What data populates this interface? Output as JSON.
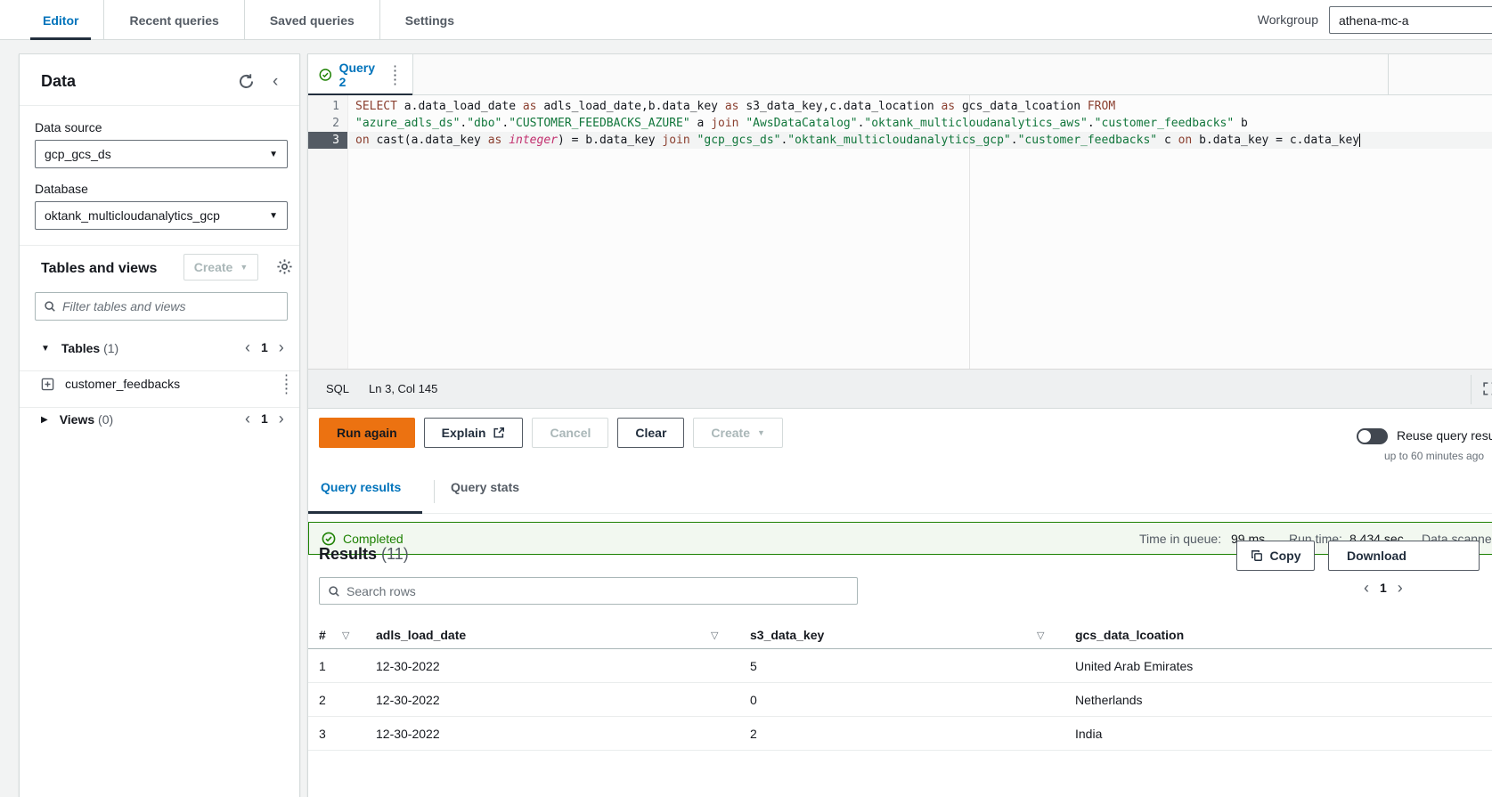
{
  "topnav": {
    "tabs": [
      {
        "label": "Editor"
      },
      {
        "label": "Recent queries"
      },
      {
        "label": "Saved queries"
      },
      {
        "label": "Settings"
      }
    ],
    "workgroup_label": "Workgroup",
    "workgroup_value": "athena-mc-a"
  },
  "sidebar": {
    "title": "Data",
    "data_source_label": "Data source",
    "data_source_value": "gcp_gcs_ds",
    "database_label": "Database",
    "database_value": "oktank_multicloudanalytics_gcp",
    "tables_views_title": "Tables and views",
    "create_label": "Create",
    "filter_placeholder": "Filter tables and views",
    "tables_label": "Tables",
    "tables_count": "(1)",
    "tables_page": "1",
    "table_item": "customer_feedbacks",
    "views_label": "Views",
    "views_count": "(0)",
    "views_page": "1"
  },
  "editor": {
    "tab_label": "Query 2",
    "status_lang": "SQL",
    "status_pos": "Ln 3, Col 145",
    "lines": [
      {
        "no": "1",
        "tokens": [
          [
            "k",
            "SELECT"
          ],
          [
            "p",
            " a.data_load_date "
          ],
          [
            "k",
            "as"
          ],
          [
            "p",
            " adls_load_date,b.data_key "
          ],
          [
            "k",
            "as"
          ],
          [
            "p",
            " s3_data_key,c.data_location "
          ],
          [
            "k",
            "as"
          ],
          [
            "p",
            " gcs_data_lcoation "
          ],
          [
            "k",
            "FROM"
          ]
        ]
      },
      {
        "no": "2",
        "tokens": [
          [
            "s",
            "\"azure_adls_ds\""
          ],
          [
            "p",
            "."
          ],
          [
            "s",
            "\"dbo\""
          ],
          [
            "p",
            "."
          ],
          [
            "s",
            "\"CUSTOMER_FEEDBACKS_AZURE\""
          ],
          [
            "p",
            " a "
          ],
          [
            "k",
            "join"
          ],
          [
            "p",
            " "
          ],
          [
            "s",
            "\"AwsDataCatalog\""
          ],
          [
            "p",
            "."
          ],
          [
            "s",
            "\"oktank_multicloudanalytics_aws\""
          ],
          [
            "p",
            "."
          ],
          [
            "s",
            "\"customer_feedbacks\""
          ],
          [
            "p",
            " b"
          ]
        ]
      },
      {
        "no": "3",
        "active": true,
        "cursor": true,
        "tokens": [
          [
            "k",
            "on"
          ],
          [
            "p",
            " cast(a.data_key "
          ],
          [
            "k",
            "as"
          ],
          [
            "p",
            " "
          ],
          [
            "t",
            "integer"
          ],
          [
            "p",
            ") = b.data_key "
          ],
          [
            "k",
            "join"
          ],
          [
            "p",
            " "
          ],
          [
            "s",
            "\"gcp_gcs_ds\""
          ],
          [
            "p",
            "."
          ],
          [
            "s",
            "\"oktank_multicloudanalytics_gcp\""
          ],
          [
            "p",
            "."
          ],
          [
            "s",
            "\"customer_feedbacks\""
          ],
          [
            "p",
            " c "
          ],
          [
            "k",
            "on"
          ],
          [
            "p",
            " b.data_key = c.data_key"
          ]
        ]
      }
    ]
  },
  "actions": {
    "run": "Run again",
    "explain": "Explain",
    "cancel": "Cancel",
    "clear": "Clear",
    "create": "Create",
    "reuse_label": "Reuse query results",
    "reuse_sub": "up to 60 minutes ago"
  },
  "results_tabs": {
    "results": "Query results",
    "stats": "Query stats"
  },
  "flashbar": {
    "status": "Completed",
    "queue_label": "Time in queue:",
    "queue_value": "99 ms",
    "runtime_label": "Run time:",
    "runtime_value": "8.434 sec",
    "scanned_label": "Data scanned:"
  },
  "results": {
    "title": "Results",
    "count": "(11)",
    "copy": "Copy",
    "download": "Download",
    "search_placeholder": "Search rows",
    "page": "1"
  },
  "table": {
    "columns": [
      "#",
      "adls_load_date",
      "s3_data_key",
      "gcs_data_lcoation"
    ],
    "rows": [
      [
        "1",
        "12-30-2022",
        "5",
        "United Arab Emirates"
      ],
      [
        "2",
        "12-30-2022",
        "0",
        "Netherlands"
      ],
      [
        "3",
        "12-30-2022",
        "2",
        "India"
      ]
    ]
  }
}
